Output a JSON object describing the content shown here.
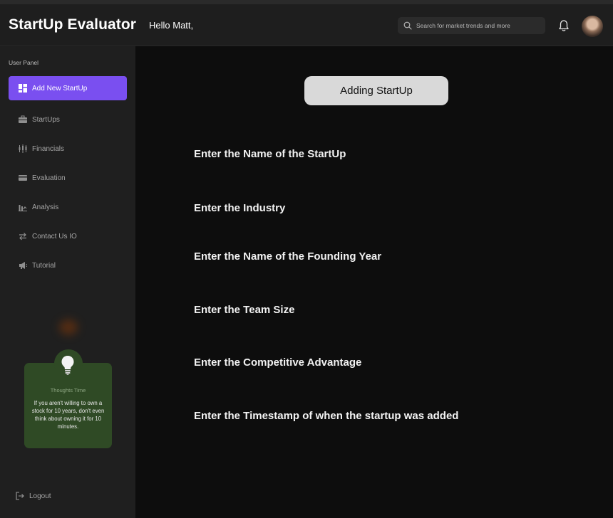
{
  "app": {
    "title": "StartUp Evaluator"
  },
  "header": {
    "greeting": "Hello Matt,",
    "search_placeholder": "Search for market trends and more"
  },
  "sidebar": {
    "panel_label": "User Panel",
    "items": [
      {
        "label": "Add New StartUp",
        "icon": "dashboard-icon",
        "active": true
      },
      {
        "label": "StartUps",
        "icon": "briefcase-icon",
        "active": false
      },
      {
        "label": "Financials",
        "icon": "candlestick-icon",
        "active": false
      },
      {
        "label": "Evaluation",
        "icon": "card-icon",
        "active": false
      },
      {
        "label": "Analysis",
        "icon": "chart-icon",
        "active": false
      },
      {
        "label": "Contact Us IO",
        "icon": "swap-arrows-icon",
        "active": false
      },
      {
        "label": "Tutorial",
        "icon": "megaphone-icon",
        "active": false
      }
    ],
    "thought": {
      "title": "Thoughts Time",
      "text": "If you aren't willing to own a stock for 10 years, don't even think about owning it for 10 minutes."
    },
    "logout_label": "Logout"
  },
  "main": {
    "title": "Adding StartUp",
    "fields": [
      "Enter the Name of the StartUp",
      "Enter the Industry",
      "Enter the Name of the Founding Year",
      "Enter the Team Size",
      "Enter the Competitive Advantage",
      "Enter the Timestamp of when the startup was added"
    ]
  },
  "colors": {
    "accent": "#7a4ff0",
    "thought_card": "#2f4a25",
    "main_bg": "#0d0d0d",
    "sidebar_bg": "#1f1f1f"
  }
}
